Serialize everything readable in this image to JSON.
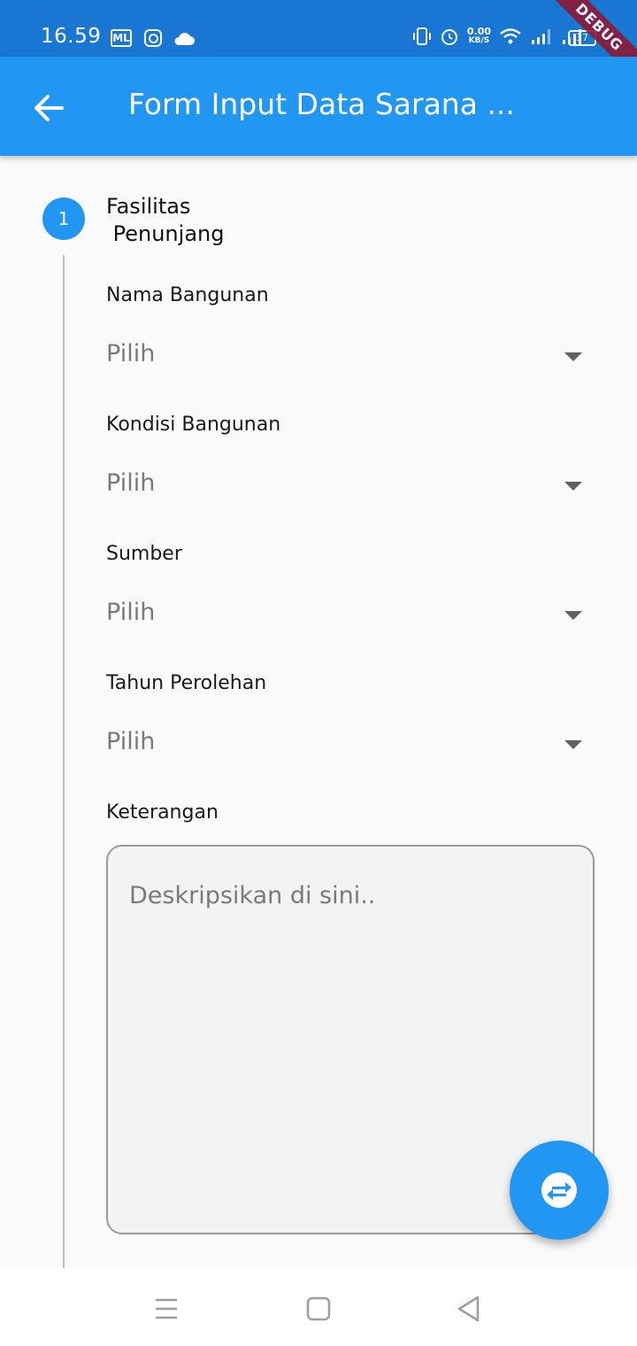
{
  "status_bar": {
    "time": "16.59",
    "ml_badge": "ML",
    "net_speed_value": "0.00",
    "net_speed_unit": "KB/S",
    "battery": "37",
    "debug_banner": "DEBUG",
    "icons": [
      "ml-icon",
      "instagram-icon",
      "cloud-icon",
      "vibrate-icon",
      "alarm-icon",
      "wifi-icon",
      "signal-icon",
      "signal-icon",
      "battery-icon"
    ]
  },
  "app_bar": {
    "title": "Form Input Data Sarana ...",
    "back_icon": "arrow-back-icon"
  },
  "stepper": {
    "step_number": "1",
    "step_title": "Fasilitas\n Penunjang"
  },
  "form": {
    "nama_bangunan": {
      "label": "Nama Bangunan",
      "value": "Pilih"
    },
    "kondisi_bangunan": {
      "label": "Kondisi Bangunan",
      "value": "Pilih"
    },
    "sumber": {
      "label": "Sumber",
      "value": "Pilih"
    },
    "tahun_perolehan": {
      "label": "Tahun Perolehan",
      "value": "Pilih"
    },
    "keterangan": {
      "label": "Keterangan",
      "placeholder": "Deskripsikan di sini.."
    }
  },
  "fab": {
    "icon": "swap-icon"
  },
  "nav_bar": {
    "icons": [
      "menu-icon",
      "home-icon",
      "back-icon"
    ]
  },
  "colors": {
    "status_bar": "#1976d2",
    "primary": "#2196f3",
    "background": "#fafafa"
  }
}
